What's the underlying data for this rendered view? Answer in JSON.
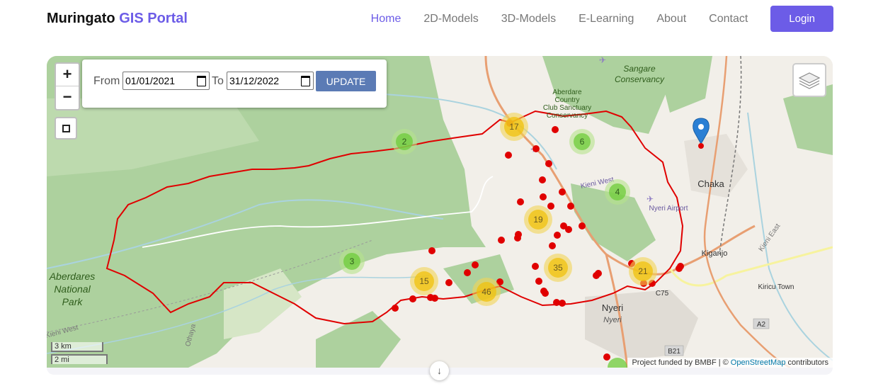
{
  "brand": {
    "name": "Muringato",
    "accent": "GIS Portal"
  },
  "nav": {
    "items": [
      {
        "label": "Home",
        "active": true
      },
      {
        "label": "2D-Models",
        "active": false
      },
      {
        "label": "3D-Models",
        "active": false
      },
      {
        "label": "E-Learning",
        "active": false
      },
      {
        "label": "About",
        "active": false
      },
      {
        "label": "Contact",
        "active": false
      }
    ],
    "login_label": "Login"
  },
  "filter": {
    "from_label": "From",
    "from_value": "01/01/2021",
    "to_label": "To",
    "to_value": "31/12/2022",
    "update_label": "UPDATE"
  },
  "map": {
    "zoom_in": "+",
    "zoom_out": "−",
    "place_labels": {
      "sangare": "Sangare",
      "conservancy": "Conservancy",
      "aberdare1": "Aberdare",
      "aberdare2": "Country",
      "aberdare3": "Club Sanctuary",
      "aberdare4": "Conservancy",
      "chaka": "Chaka",
      "nyeri_airport": "Nyeri Airport",
      "kieni_west": "Kieni West",
      "kiganjo": "Kiganjo",
      "kiricu": "Kiricu Town",
      "aberdares1": "Aberdares",
      "aberdares2": "National",
      "aberdares3": "Park",
      "nyeri": "Nyeri",
      "nyeri2": "Nyeri",
      "othaya": "Othaya",
      "kieni_west2": "Kieni West",
      "kieni_east": "Kieni East",
      "a2": "A2",
      "b21": "B21",
      "c75": "C75"
    },
    "clusters": [
      {
        "count": "17",
        "color": "yellow"
      },
      {
        "count": "2",
        "color": "green"
      },
      {
        "count": "6",
        "color": "green"
      },
      {
        "count": "4",
        "color": "green"
      },
      {
        "count": "19",
        "color": "yellow"
      },
      {
        "count": "3",
        "color": "green"
      },
      {
        "count": "15",
        "color": "yellow"
      },
      {
        "count": "46",
        "color": "yellow"
      },
      {
        "count": "35",
        "color": "yellow"
      },
      {
        "count": "21",
        "color": "yellow"
      }
    ],
    "scale": {
      "km": "3 km",
      "mi": "2 mi"
    },
    "attribution": {
      "prefix": "Project funded by BMBF | ©",
      "link": "OpenStreetMap",
      "suffix": "contributors"
    },
    "colors": {
      "boundary": "#e00000",
      "point": "#e00000",
      "forest": "#add19e",
      "water": "#aad3df",
      "road": "#e89f72",
      "marker": "#2a7fd4"
    }
  },
  "scroll_down_icon": "arrow-down-icon"
}
